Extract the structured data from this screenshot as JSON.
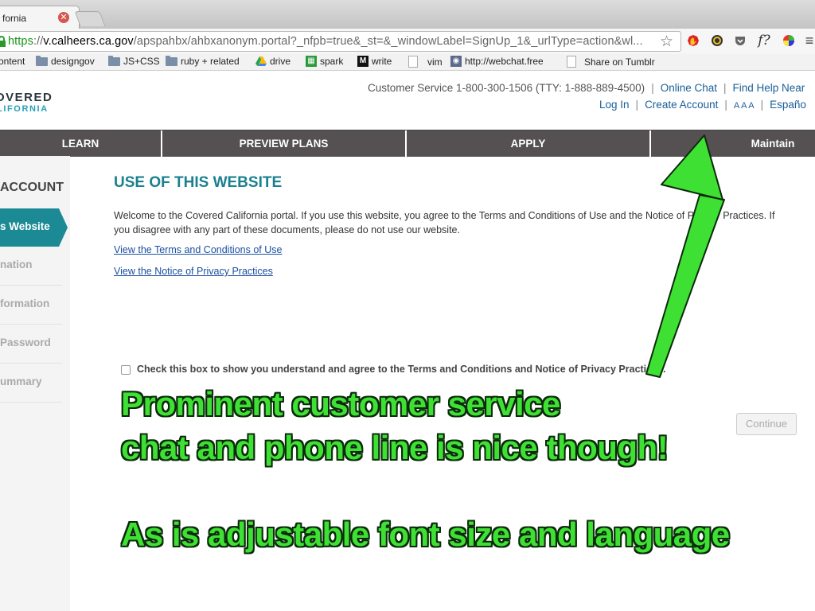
{
  "browser": {
    "tab_title": "fornia",
    "url_scheme": "https",
    "url_host": "v.calheers.ca.gov",
    "url_path": "/apspahbx/ahbxanonym.portal?_nfpb=true&_st=&_windowLabel=SignUp_1&_urlType=action&wl...",
    "bookmarks": [
      "ontent",
      "designgov",
      "JS+CSS",
      "ruby + related",
      "drive",
      "spark",
      "write",
      "vim",
      "http://webchat.freer",
      "Share on Tumblr"
    ],
    "extensions": [
      "star-icon",
      "stop-hand-icon",
      "color-wheel-icon",
      "pocket-icon",
      "formula-icon",
      "chrome-icon"
    ]
  },
  "header": {
    "logo_line1": "OVERED",
    "logo_line2": "LIFORNIA",
    "customer_service": "Customer Service 1-800-300-1506 (TTY: 1-888-889-4500)",
    "online_chat": "Online Chat",
    "find_help": "Find Help Near",
    "log_in": "Log In",
    "create_account": "Create Account",
    "font_sizes": "A A A",
    "language": "Españo"
  },
  "nav": {
    "items": [
      "LEARN",
      "PREVIEW PLANS",
      "APPLY",
      "Maintain"
    ]
  },
  "sidebar": {
    "heading": "ACCOUNT",
    "active": "s Website",
    "items": [
      "nation",
      "formation",
      "Password",
      "ummary"
    ]
  },
  "content": {
    "title": "USE OF THIS WEBSITE",
    "paragraph": "Welcome to the Covered California portal. If you use this website, you agree to the Terms and Conditions of Use and the Notice of Privacy Practices. If you disagree with any part of these documents, please do not use our website.",
    "link_terms": "View the Terms and Conditions of Use",
    "link_privacy": "View the Notice of Privacy Practices",
    "checkbox_label": "Check this box to show you understand and agree to the Terms and Conditions and Notice of Privacy Practices.",
    "checkbox_checked": false,
    "continue_label": "Continue"
  },
  "annotation": {
    "line1": "Prominent customer service",
    "line2": "chat and phone line is nice though!",
    "line3": "As is adjustable font size and language",
    "color": "#3fe034"
  }
}
